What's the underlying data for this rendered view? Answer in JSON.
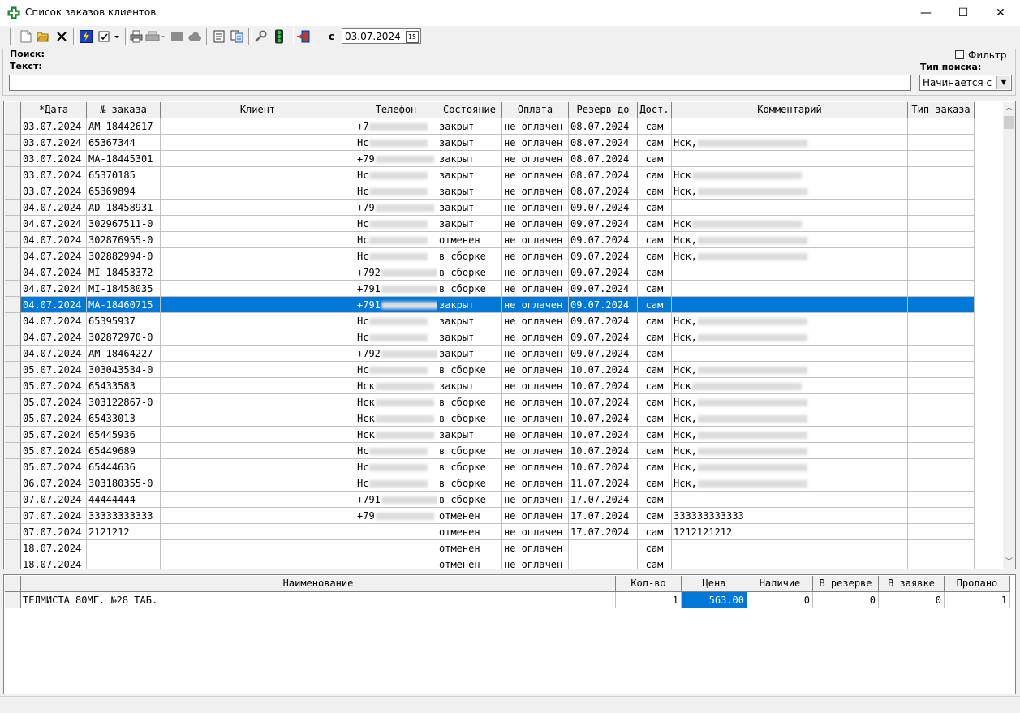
{
  "window": {
    "title": "Список заказов клиентов",
    "min": "—",
    "max": "☐",
    "close": "✕"
  },
  "toolbar": {
    "icons": [
      "new-doc-icon",
      "open-folder-icon",
      "delete-icon",
      "lightning-icon",
      "checkbox-dropdown-icon",
      "print-icon",
      "print-preview-icon",
      "gray-box-icon",
      "gray-cloud-icon",
      "document-icon",
      "documents-icon",
      "wrench-icon",
      "traffic-light-icon",
      "exit-door-icon"
    ],
    "date_label": "с",
    "date_value": "03.07.2024",
    "date_cal_icon": "15"
  },
  "search": {
    "group_label": "Поиск:",
    "text_label": "Текст:",
    "text_value": "",
    "filter_label": "Фильтр",
    "filter_checked": false,
    "type_label": "Тип поиска:",
    "type_value": "Начинается с"
  },
  "orders": {
    "columns": [
      "*Дата",
      "№ заказа",
      "Клиент",
      "Телефон",
      "Состояние",
      "Оплата",
      "Резерв до",
      "Дост.",
      "Комментарий",
      "Тип заказа"
    ],
    "selected_index": 11,
    "rows": [
      {
        "date": "03.07.2024",
        "num": "AM-18442617",
        "client": "",
        "phone": "+7",
        "state": "закрыт",
        "pay": "не оплачен",
        "reserve": "08.07.2024",
        "del": "сам",
        "comment": "",
        "type": ""
      },
      {
        "date": "03.07.2024",
        "num": "65367344",
        "client": "",
        "phone": "Нс",
        "state": "закрыт",
        "pay": "не оплачен",
        "reserve": "08.07.2024",
        "del": "сам",
        "comment": "Нск,",
        "type": ""
      },
      {
        "date": "03.07.2024",
        "num": "MA-18445301",
        "client": "",
        "phone": "+79",
        "state": "закрыт",
        "pay": "не оплачен",
        "reserve": "08.07.2024",
        "del": "сам",
        "comment": "",
        "type": ""
      },
      {
        "date": "03.07.2024",
        "num": "65370185",
        "client": "",
        "phone": "Нс",
        "state": "закрыт",
        "pay": "не оплачен",
        "reserve": "08.07.2024",
        "del": "сам",
        "comment": "Нск",
        "type": ""
      },
      {
        "date": "03.07.2024",
        "num": "65369894",
        "client": "",
        "phone": "Нс",
        "state": "закрыт",
        "pay": "не оплачен",
        "reserve": "08.07.2024",
        "del": "сам",
        "comment": "Нск,",
        "type": ""
      },
      {
        "date": "04.07.2024",
        "num": "AD-18458931",
        "client": "",
        "phone": "+79",
        "state": "закрыт",
        "pay": "не оплачен",
        "reserve": "09.07.2024",
        "del": "сам",
        "comment": "",
        "type": ""
      },
      {
        "date": "04.07.2024",
        "num": "302967511-0",
        "client": "",
        "phone": "Нс",
        "state": "закрыт",
        "pay": "не оплачен",
        "reserve": "09.07.2024",
        "del": "сам",
        "comment": "Нск",
        "type": ""
      },
      {
        "date": "04.07.2024",
        "num": "302876955-0",
        "client": "",
        "phone": "Нс",
        "state": "отменен",
        "pay": "не оплачен",
        "reserve": "09.07.2024",
        "del": "сам",
        "comment": "Нск,",
        "type": ""
      },
      {
        "date": "04.07.2024",
        "num": "302882994-0",
        "client": "",
        "phone": "Нс",
        "state": "в сборке",
        "pay": "не оплачен",
        "reserve": "09.07.2024",
        "del": "сам",
        "comment": "Нск,",
        "type": ""
      },
      {
        "date": "04.07.2024",
        "num": "MI-18453372",
        "client": "",
        "phone": "+792",
        "state": "в сборке",
        "pay": "не оплачен",
        "reserve": "09.07.2024",
        "del": "сам",
        "comment": "",
        "type": ""
      },
      {
        "date": "04.07.2024",
        "num": "MI-18458035",
        "client": "",
        "phone": "+791",
        "state": "в сборке",
        "pay": "не оплачен",
        "reserve": "09.07.2024",
        "del": "сам",
        "comment": "",
        "type": ""
      },
      {
        "date": "04.07.2024",
        "num": "MA-18460715",
        "client": "",
        "phone": "+791",
        "state": "закрыт",
        "pay": "не оплачен",
        "reserve": "09.07.2024",
        "del": "сам",
        "comment": "",
        "type": ""
      },
      {
        "date": "04.07.2024",
        "num": "65395937",
        "client": "",
        "phone": "Нс",
        "state": "закрыт",
        "pay": "не оплачен",
        "reserve": "09.07.2024",
        "del": "сам",
        "comment": "Нск,",
        "type": ""
      },
      {
        "date": "04.07.2024",
        "num": "302872970-0",
        "client": "",
        "phone": "Нс",
        "state": "закрыт",
        "pay": "не оплачен",
        "reserve": "09.07.2024",
        "del": "сам",
        "comment": "Нск,",
        "type": ""
      },
      {
        "date": "04.07.2024",
        "num": "AM-18464227",
        "client": "",
        "phone": "+792",
        "state": "закрыт",
        "pay": "не оплачен",
        "reserve": "09.07.2024",
        "del": "сам",
        "comment": "",
        "type": ""
      },
      {
        "date": "05.07.2024",
        "num": "303043534-0",
        "client": "",
        "phone": "Нс",
        "state": "в сборке",
        "pay": "не оплачен",
        "reserve": "10.07.2024",
        "del": "сам",
        "comment": "Нск,",
        "type": ""
      },
      {
        "date": "05.07.2024",
        "num": "65433583",
        "client": "",
        "phone": "Нск",
        "state": "закрыт",
        "pay": "не оплачен",
        "reserve": "10.07.2024",
        "del": "сам",
        "comment": "Нск",
        "type": ""
      },
      {
        "date": "05.07.2024",
        "num": "303122867-0",
        "client": "",
        "phone": "Нск",
        "state": "в сборке",
        "pay": "не оплачен",
        "reserve": "10.07.2024",
        "del": "сам",
        "comment": "Нск,",
        "type": ""
      },
      {
        "date": "05.07.2024",
        "num": "65433013",
        "client": "",
        "phone": "Нск",
        "state": "в сборке",
        "pay": "не оплачен",
        "reserve": "10.07.2024",
        "del": "сам",
        "comment": "Нск,",
        "type": ""
      },
      {
        "date": "05.07.2024",
        "num": "65445936",
        "client": "",
        "phone": "Нск",
        "state": "закрыт",
        "pay": "не оплачен",
        "reserve": "10.07.2024",
        "del": "сам",
        "comment": "Нск,",
        "type": ""
      },
      {
        "date": "05.07.2024",
        "num": "65449689",
        "client": "",
        "phone": "Нс",
        "state": "в сборке",
        "pay": "не оплачен",
        "reserve": "10.07.2024",
        "del": "сам",
        "comment": "Нск,",
        "type": ""
      },
      {
        "date": "05.07.2024",
        "num": "65444636",
        "client": "",
        "phone": "Нс",
        "state": "в сборке",
        "pay": "не оплачен",
        "reserve": "10.07.2024",
        "del": "сам",
        "comment": "Нск,",
        "type": ""
      },
      {
        "date": "06.07.2024",
        "num": "303180355-0",
        "client": "",
        "phone": "Нс",
        "state": "в сборке",
        "pay": "не оплачен",
        "reserve": "11.07.2024",
        "del": "сам",
        "comment": "Нск,",
        "type": ""
      },
      {
        "date": "07.07.2024",
        "num": "44444444",
        "client": "",
        "phone": "+791",
        "state": "в сборке",
        "pay": "не оплачен",
        "reserve": "17.07.2024",
        "del": "сам",
        "comment": "",
        "type": ""
      },
      {
        "date": "07.07.2024",
        "num": "33333333333",
        "client": "",
        "phone": "+79",
        "state": "отменен",
        "pay": "не оплачен",
        "reserve": "17.07.2024",
        "del": "сам",
        "comment": "333333333333",
        "type": ""
      },
      {
        "date": "07.07.2024",
        "num": "2121212",
        "client": "",
        "phone": "",
        "state": "отменен",
        "pay": "не оплачен",
        "reserve": "17.07.2024",
        "del": "сам",
        "comment": "1212121212",
        "type": ""
      },
      {
        "date": "18.07.2024",
        "num": "",
        "client": "",
        "phone": "",
        "state": "отменен",
        "pay": "не оплачен",
        "reserve": "",
        "del": "сам",
        "comment": "",
        "type": ""
      },
      {
        "date": "18.07.2024",
        "num": "",
        "client": "",
        "phone": "",
        "state": "отменен",
        "pay": "не оплачен",
        "reserve": "",
        "del": "сам",
        "comment": "",
        "type": ""
      }
    ]
  },
  "items": {
    "columns": [
      "Наименование",
      "Кол-во",
      "Цена",
      "Наличие",
      "В резерве",
      "В заявке",
      "Продано"
    ],
    "rows": [
      {
        "name": "ТЕЛМИСТА 80МГ. №28 ТАБ.",
        "qty": "1",
        "price": "563.00",
        "stock": "0",
        "reserved": "0",
        "requested": "0",
        "sold": "1"
      }
    ]
  },
  "colors": {
    "selection": "#0078d7",
    "grid_line": "#c0c0c0"
  }
}
